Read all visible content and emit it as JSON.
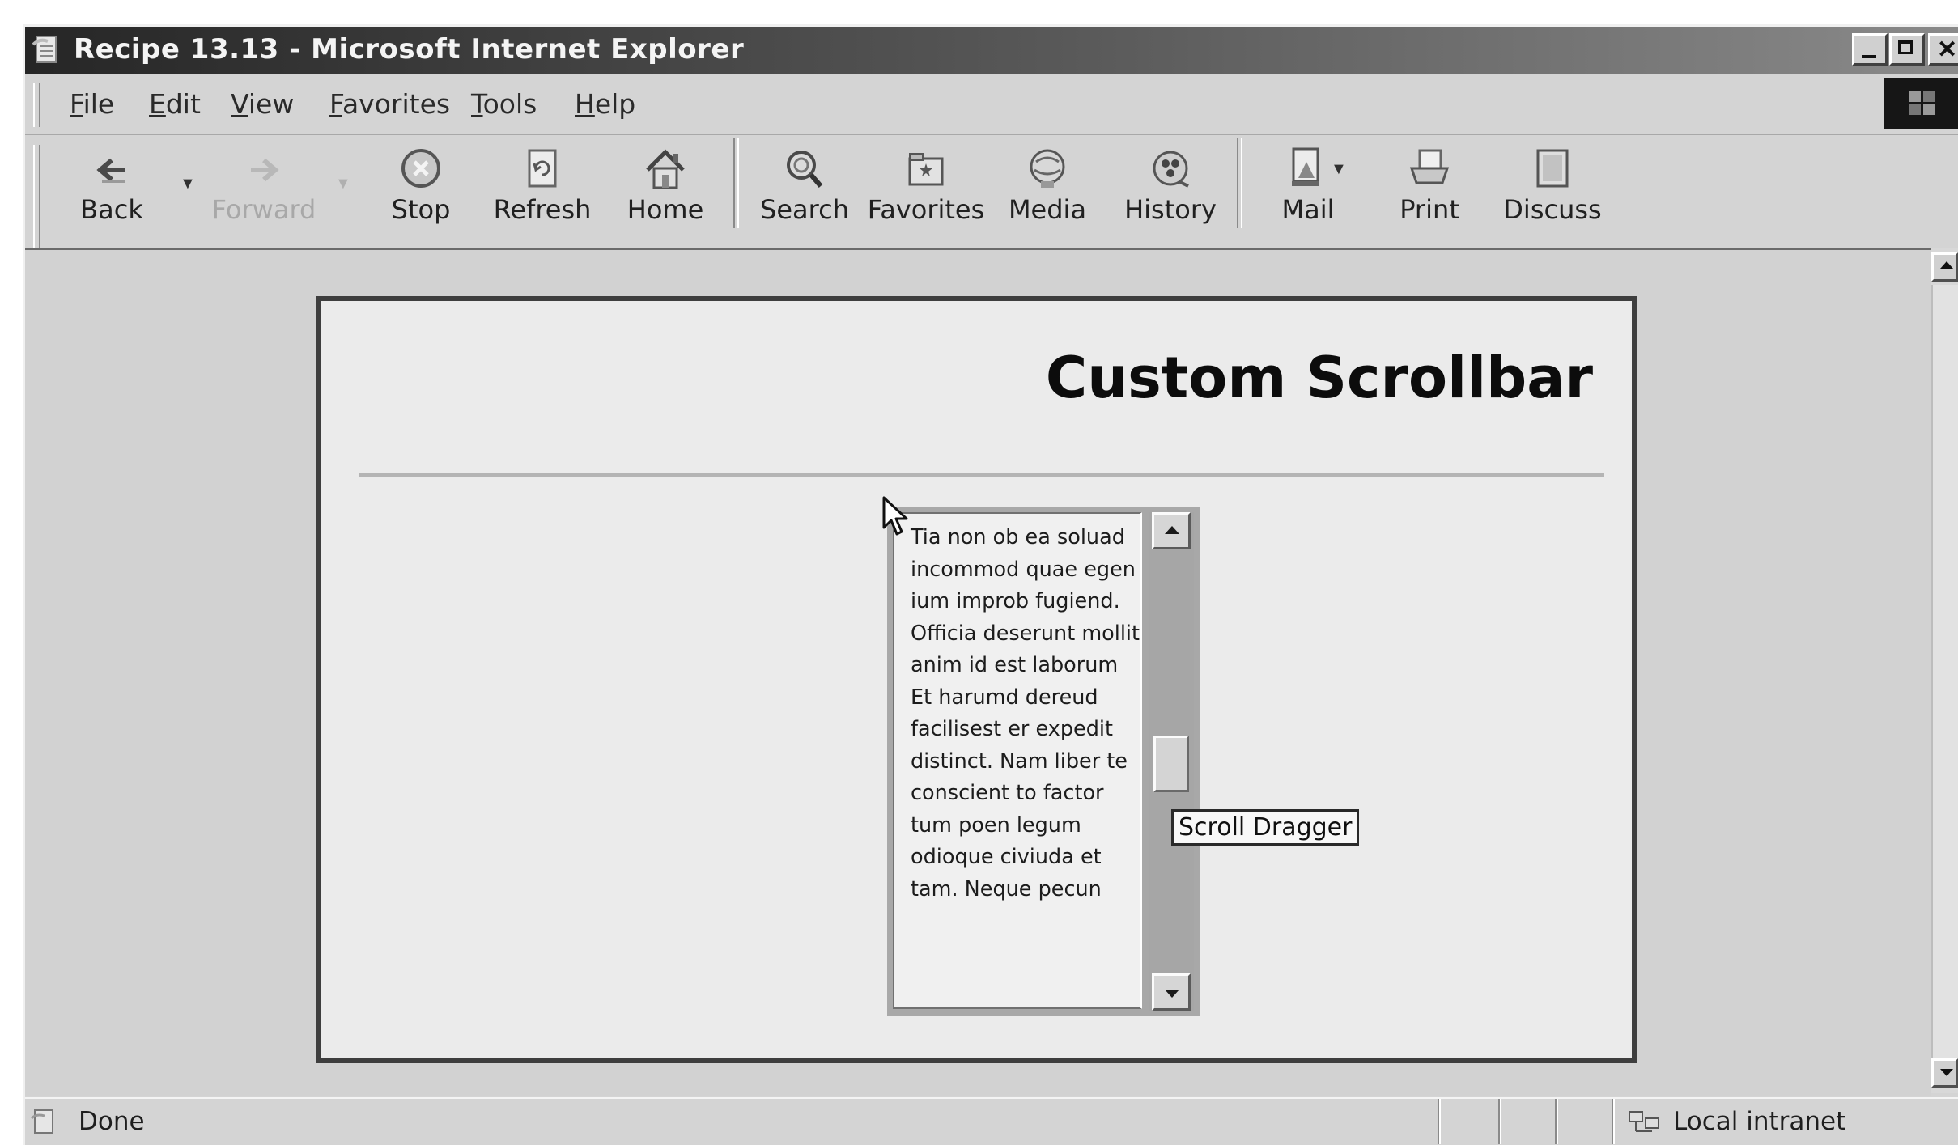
{
  "window": {
    "title": "Recipe 13.13 - Microsoft Internet Explorer"
  },
  "menu": [
    "File",
    "Edit",
    "View",
    "Favorites",
    "Tools",
    "Help"
  ],
  "toolbar": {
    "back": "Back",
    "forward": "Forward",
    "stop": "Stop",
    "refresh": "Refresh",
    "home": "Home",
    "search": "Search",
    "favorites": "Favorites",
    "media": "Media",
    "history": "History",
    "mail": "Mail",
    "print": "Print",
    "discuss": "Discuss"
  },
  "page": {
    "title": "Custom Scrollbar",
    "scroll_text": "Tia non ob ea soluad incommod quae egen ium improb fugiend. Officia deserunt mollit anim id est laborum Et harumd dereud facilisest er expedit distinct. Nam liber te conscient to factor tum poen legum odioque civiuda et tam. Neque pecun",
    "tooltip": "Scroll Dragger"
  },
  "status": {
    "text": "Done",
    "zone": "Local intranet"
  },
  "colors": {
    "titlebar_start": "#262626",
    "chrome": "#d4d4d4",
    "page_background": "#ebebeb"
  }
}
